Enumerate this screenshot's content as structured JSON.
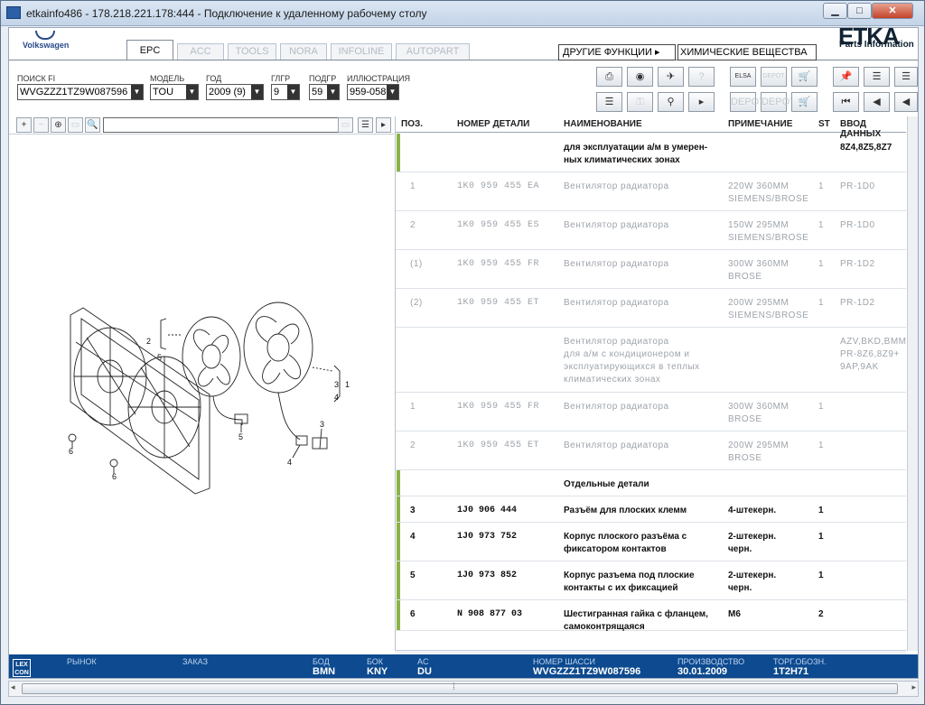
{
  "window": {
    "title": "etkainfo486 - 178.218.221.178:444 - Подключение к удаленному рабочему столу",
    "min_glyph": "▁",
    "max_glyph": "□",
    "close_glyph": "✕"
  },
  "brand": {
    "vw_label": "Volkswagen",
    "etka": "ETKA",
    "etka_sub": "Parts Information"
  },
  "tabs": [
    "EPC",
    "ACC",
    "TOOLS",
    "NORA",
    "INFOLINE",
    "AUTOPART"
  ],
  "active_tab": "EPC",
  "functions": {
    "other_label": "ДРУГИЕ ФУНКЦИИ ▸",
    "chem_value": "ХИМИЧЕСКИЕ ВЕЩЕСТВА"
  },
  "filters": [
    {
      "label": "ПОИСК FI",
      "value": "WVGZZZ1TZ9W087596"
    },
    {
      "label": "МОДЕЛЬ",
      "value": "TOU"
    },
    {
      "label": "ГОД",
      "value": "2009 (9)"
    },
    {
      "label": "ГЛГР",
      "value": "9"
    },
    {
      "label": "ПОДГР",
      "value": "59"
    },
    {
      "label": "ИЛЛЮСТРАЦИЯ",
      "value": "959-058"
    }
  ],
  "toolbar_icons": {
    "print": "⎙",
    "cd": "◉",
    "tools": "✈",
    "help": "?",
    "elsa": "ELSA",
    "depot": "DEPOT",
    "cart": "🛒",
    "list": "☰",
    "key": "⚿",
    "bike": "⚲",
    "play": "▸",
    "pin": "📌",
    "first": "⏮",
    "prev": "◀"
  },
  "image_toolbar": {
    "zoom_in": "+",
    "zoom_out": "−",
    "zoom_fit": "⊕",
    "zoom_sel": "▭",
    "find": "🔍"
  },
  "table": {
    "headers": [
      "ПОЗ.",
      "НОМЕР ДЕТАЛИ",
      "НАИМЕНОВАНИЕ",
      "ПРИМЕЧАНИЕ",
      "ST",
      "ВВОД ДАННЫХ"
    ],
    "rows": [
      {
        "pos": "",
        "part": "",
        "name": "для эксплуатации а/м в умерен-\nных климатических зонах",
        "note": "",
        "st": "",
        "data": "8Z4,8Z5,8Z7",
        "style": "bold",
        "bar": true
      },
      {
        "pos": "1",
        "part": "1K0 959 455 EA",
        "name": "Вентилятор радиатора",
        "note": "220W    360MM\nSIEMENS/BROSE",
        "st": "1",
        "data": "PR-1D0",
        "style": "grey",
        "bar": false
      },
      {
        "pos": "2",
        "part": "1K0 959 455 ES",
        "name": "Вентилятор радиатора",
        "note": "150W    295MM\nSIEMENS/BROSE",
        "st": "1",
        "data": "PR-1D0",
        "style": "grey",
        "bar": false
      },
      {
        "pos": "(1)",
        "part": "1K0 959 455 FR",
        "name": "Вентилятор радиатора",
        "note": "300W    360MM\nBROSE",
        "st": "1",
        "data": "PR-1D2",
        "style": "grey",
        "bar": false
      },
      {
        "pos": "(2)",
        "part": "1K0 959 455 ET",
        "name": "Вентилятор радиатора",
        "note": "200W    295MM\nSIEMENS/BROSE",
        "st": "1",
        "data": "PR-1D2",
        "style": "grey",
        "bar": false
      },
      {
        "pos": "",
        "part": "",
        "name": "Вентилятор радиатора\nдля а/м с кондиционером и\nэксплуатирующихся в теплых\nклиматических зонах",
        "note": "",
        "st": "",
        "data": "AZV,BKD,BMM\nPR-8Z6,8Z9+\n9AP,9AK",
        "style": "grey",
        "bar": false
      },
      {
        "pos": "1",
        "part": "1K0 959 455 FR",
        "name": "Вентилятор радиатора",
        "note": "300W    360MM\nBROSE",
        "st": "1",
        "data": "",
        "style": "grey",
        "bar": false
      },
      {
        "pos": "2",
        "part": "1K0 959 455 ET",
        "name": "Вентилятор радиатора",
        "note": "200W    295MM\nBROSE",
        "st": "1",
        "data": "",
        "style": "grey",
        "bar": false
      },
      {
        "pos": "",
        "part": "",
        "name": "Отдельные детали",
        "note": "",
        "st": "",
        "data": "",
        "style": "bold",
        "bar": true
      },
      {
        "pos": "3",
        "part": "1J0 906 444",
        "name": "Разъём для плоских клемм",
        "note": "4-штекерн.",
        "st": "1",
        "data": "",
        "style": "bold",
        "bar": true
      },
      {
        "pos": "4",
        "part": "1J0 973 752",
        "name": "Корпус плоского разъёма с\nфиксатором контактов",
        "note": "2-штекерн.\nчерн.",
        "st": "1",
        "data": "",
        "style": "bold",
        "bar": true
      },
      {
        "pos": "5",
        "part": "1J0 973 852",
        "name": "Корпус разъема под плоские\nконтакты с их фиксацией",
        "note": "2-штекерн.\nчерн.",
        "st": "1",
        "data": "",
        "style": "bold",
        "bar": true
      },
      {
        "pos": "6",
        "part": "N    908 877 03",
        "name": "Шестигранная гайка с фланцем,\nсамоконтрящаяся",
        "note": "M6",
        "st": "2",
        "data": "",
        "style": "bold",
        "bar": true
      }
    ]
  },
  "diagram_labels": [
    "2",
    "5",
    "1",
    "3",
    "4",
    "5",
    "3",
    "4",
    "6",
    "6"
  ],
  "statusbar": {
    "lexcon": "LEX\nCON",
    "fields": [
      {
        "label": "РЫНОК",
        "value": ""
      },
      {
        "label": "ЗАКАЗ",
        "value": ""
      },
      {
        "label": "БОД",
        "value": "BMN"
      },
      {
        "label": "БОК",
        "value": "KNY"
      },
      {
        "label": "AC",
        "value": "DU"
      },
      {
        "label": "НОМЕР ШАССИ",
        "value": "WVGZZZ1TZ9W087596"
      },
      {
        "label": "ПРОИЗВОДСТВО",
        "value": "30.01.2009"
      },
      {
        "label": "ТОРГ.ОБОЗН.",
        "value": "1T2H71"
      }
    ]
  },
  "scroll": {
    "left": "◂",
    "right": "▸",
    "grip": "⁞"
  }
}
